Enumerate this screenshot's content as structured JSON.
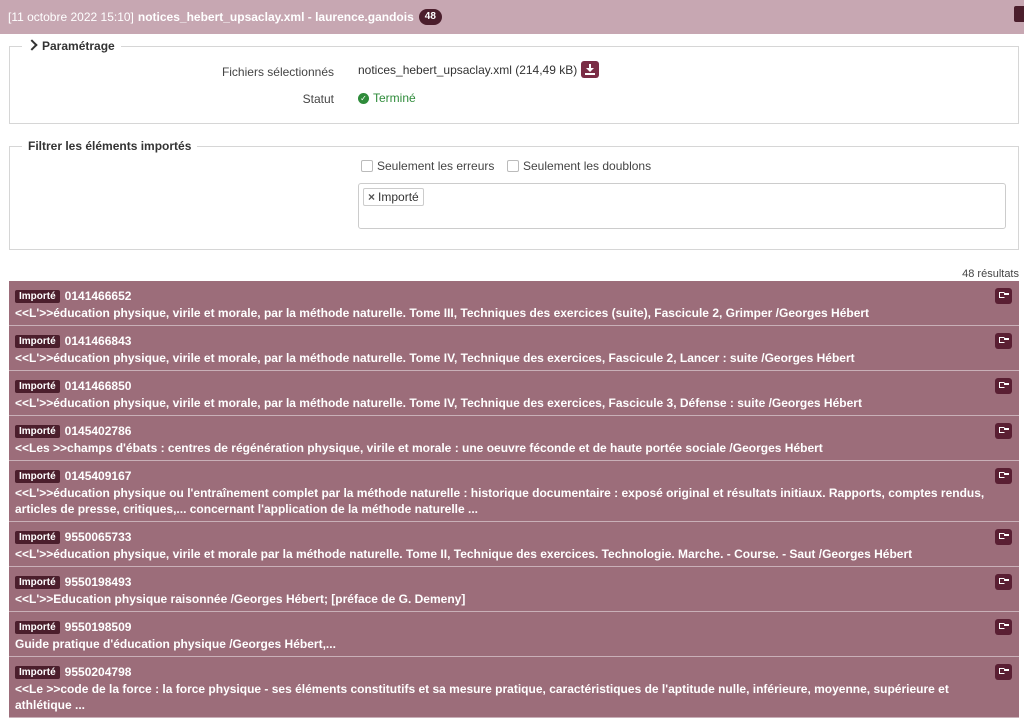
{
  "header": {
    "date": "[11 octobre 2022 15:10]",
    "title": "notices_hebert_upsaclay.xml - laurence.gandois",
    "count_badge": "48"
  },
  "settings": {
    "legend": "Paramétrage",
    "files_label": "Fichiers sélectionnés",
    "files_value": "notices_hebert_upsaclay.xml (214,49 kB)",
    "status_label": "Statut",
    "status_value": "Terminé"
  },
  "filter": {
    "legend": "Filtrer les éléments importés",
    "errors_only": "Seulement les erreurs",
    "duplicates_only": "Seulement les doublons",
    "tag": "Importé"
  },
  "results": {
    "count": "48 résultats",
    "items": [
      {
        "status": "Importé",
        "id": "0141466652",
        "desc": "<<L'>>éducation physique, virile et morale, par la méthode naturelle. Tome III, Techniques des exercices (suite), Fascicule 2, Grimper /Georges Hébert"
      },
      {
        "status": "Importé",
        "id": "0141466843",
        "desc": "<<L'>>éducation physique, virile et morale, par la méthode naturelle. Tome IV, Technique des exercices, Fascicule 2, Lancer : suite /Georges Hébert"
      },
      {
        "status": "Importé",
        "id": "0141466850",
        "desc": "<<L'>>éducation physique, virile et morale, par la méthode naturelle. Tome IV, Technique des exercices, Fascicule 3, Défense : suite /Georges Hébert"
      },
      {
        "status": "Importé",
        "id": "0145402786",
        "desc": "<<Les >>champs d'ébats : centres de régénération physique, virile et morale : une oeuvre féconde et de haute portée sociale /Georges Hébert"
      },
      {
        "status": "Importé",
        "id": "0145409167",
        "desc": "<<L'>>éducation physique ou l'entraînement complet par la méthode naturelle : historique documentaire : exposé original et résultats initiaux. Rapports, comptes rendus, articles de presse, critiques,... concernant l'application de la méthode naturelle ..."
      },
      {
        "status": "Importé",
        "id": "9550065733",
        "desc": "<<L'>>éducation physique, virile et morale par la méthode naturelle. Tome II, Technique des exercices. Technologie. Marche. - Course. - Saut /Georges Hébert"
      },
      {
        "status": "Importé",
        "id": "9550198493",
        "desc": "<<L'>>Education physique raisonnée /Georges Hébert; [préface de G. Demeny]"
      },
      {
        "status": "Importé",
        "id": "9550198509",
        "desc": "Guide pratique d'éducation physique /Georges Hébert,..."
      },
      {
        "status": "Importé",
        "id": "9550204798",
        "desc": "<<Le >>code de la force : la force physique - ses éléments constitutifs et sa mesure pratique, caractéristiques de l'aptitude nulle, inférieure, moyenne, supérieure et athlétique ..."
      }
    ]
  }
}
